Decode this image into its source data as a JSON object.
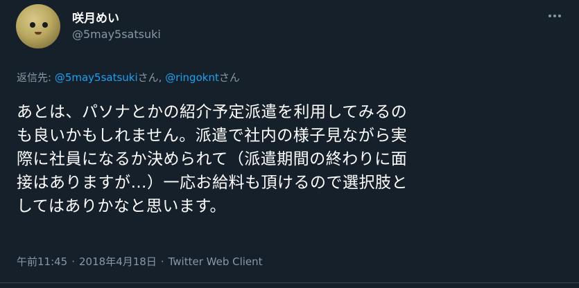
{
  "colors": {
    "background": "#15202b",
    "primary_text": "#ffffff",
    "secondary_text": "#8899a6",
    "link": "#1da1f2"
  },
  "author": {
    "display_name": "咲月めい",
    "handle": "@5may5satsuki",
    "avatar_icon": "avatar-icon"
  },
  "more_icon": "more-options-icon",
  "reply": {
    "prefix": "返信先: ",
    "mention_1": "@5may5satsuki",
    "honorific_1": "さん, ",
    "mention_2": "@ringoknt",
    "honorific_2": "さん"
  },
  "body_lines": [
    "あとは、パソナとかの紹介予定派遣を利用してみるの",
    "も良いかもしれません。派遣で社内の様子見ながら実",
    "際に社員になるか決められて（派遣期間の終わりに面",
    "接はありますが…）一応お給料も頂けるので選択肢と",
    "してはありかなと思います。"
  ],
  "meta": {
    "time": "午前11:45",
    "separator": "·",
    "date": "2018年4月18日",
    "source": "Twitter Web Client"
  }
}
